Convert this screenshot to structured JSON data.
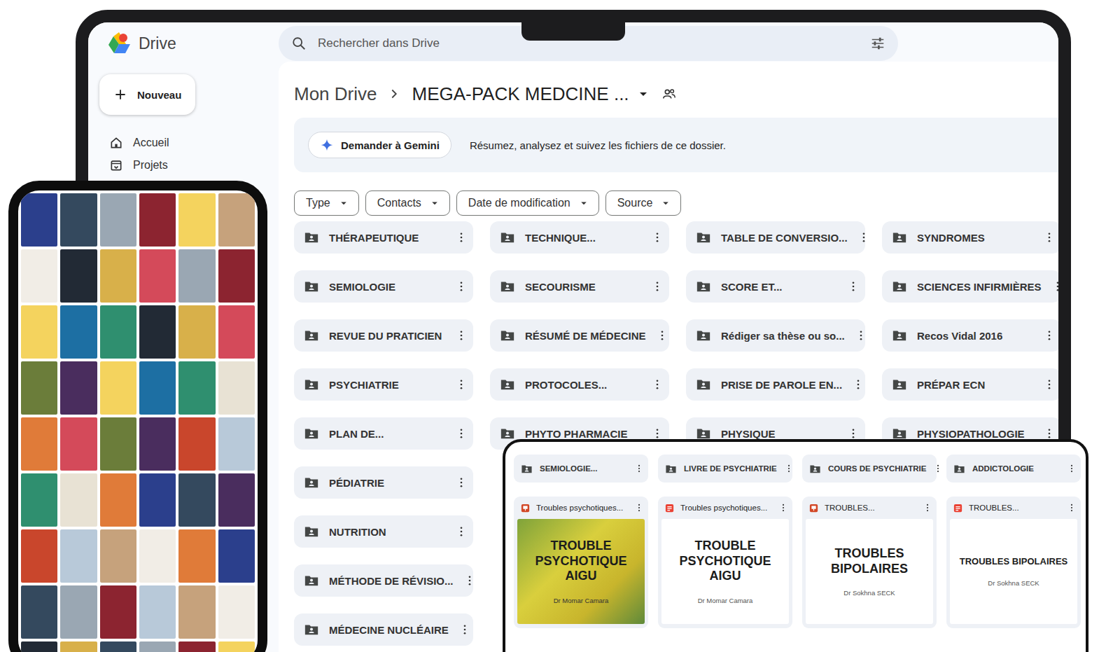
{
  "app": {
    "name": "Drive"
  },
  "search": {
    "placeholder": "Rechercher dans Drive"
  },
  "new_button": {
    "label": "Nouveau"
  },
  "sidebar": {
    "items": [
      {
        "label": "Accueil",
        "selected": false
      },
      {
        "label": "Projets",
        "selected": false
      }
    ]
  },
  "breadcrumb": [
    {
      "label": "Mon Drive"
    },
    {
      "label": "MEGA-PACK MEDCINE ..."
    }
  ],
  "gemini": {
    "button": "Demander à Gemini",
    "prompt": "Résumez, analysez et suivez les fichiers de ce dossier."
  },
  "filters": [
    "Type",
    "Contacts",
    "Date de modification",
    "Source"
  ],
  "folder_rows": [
    [
      "THÉRAPEUTIQUE",
      "TECHNIQUE...",
      "TABLE DE CONVERSIO...",
      "SYNDROMES"
    ],
    [
      "SEMIOLOGIE",
      "SECOURISME",
      "SCORE ET...",
      "SCIENCES INFIRMIÈRES"
    ],
    [
      "REVUE DU PRATICIEN",
      "RÉSUMÉ DE MÉDECINE",
      "Rédiger sa thèse ou so...",
      "Recos Vidal 2016"
    ],
    [
      "PSYCHIATRIE",
      "PROTOCOLES...",
      "PRISE DE PAROLE EN...",
      "PRÉPAR ECN"
    ],
    [
      "PLAN DE...",
      "PHYTO PHARMACIE",
      "PHYSIQUE",
      "PHYSIOPATHOLOGIE"
    ],
    [
      "PÉDIATRIE"
    ],
    [
      "NUTRITION"
    ],
    [
      "MÉTHODE DE RÉVISIO..."
    ],
    [
      "MÉDECINE NUCLÉAIRE"
    ]
  ],
  "inset": {
    "folders": [
      "SEMIOLOGIE...",
      "LIVRE DE PSYCHIATRIE",
      "COURS DE PSYCHIATRIE",
      "ADDICTOLOGIE"
    ],
    "files": [
      {
        "name": "Troubles psychotiques...",
        "kind": "slides",
        "thumbnail": {
          "title": "TROUBLE PSYCHOTIQUE AIGU",
          "author": "Dr Momar Camara",
          "kind": "image"
        }
      },
      {
        "name": "Troubles psychotiques...",
        "kind": "pdf",
        "thumbnail": {
          "title": "TROUBLE PSYCHOTIQUE AIGU",
          "author": "Dr Momar Camara",
          "kind": "plain"
        }
      },
      {
        "name": "TROUBLES...",
        "kind": "slides",
        "thumbnail": {
          "title": "TROUBLES BIPOLAIRES",
          "author": "Dr Sokhna SECK",
          "kind": "plain"
        }
      },
      {
        "name": "TROUBLES...",
        "kind": "pdf",
        "thumbnail": {
          "title": "TROUBLES BIPOLAIRES",
          "author": "Dr Sokhna SECK",
          "kind": "plain"
        }
      }
    ]
  }
}
